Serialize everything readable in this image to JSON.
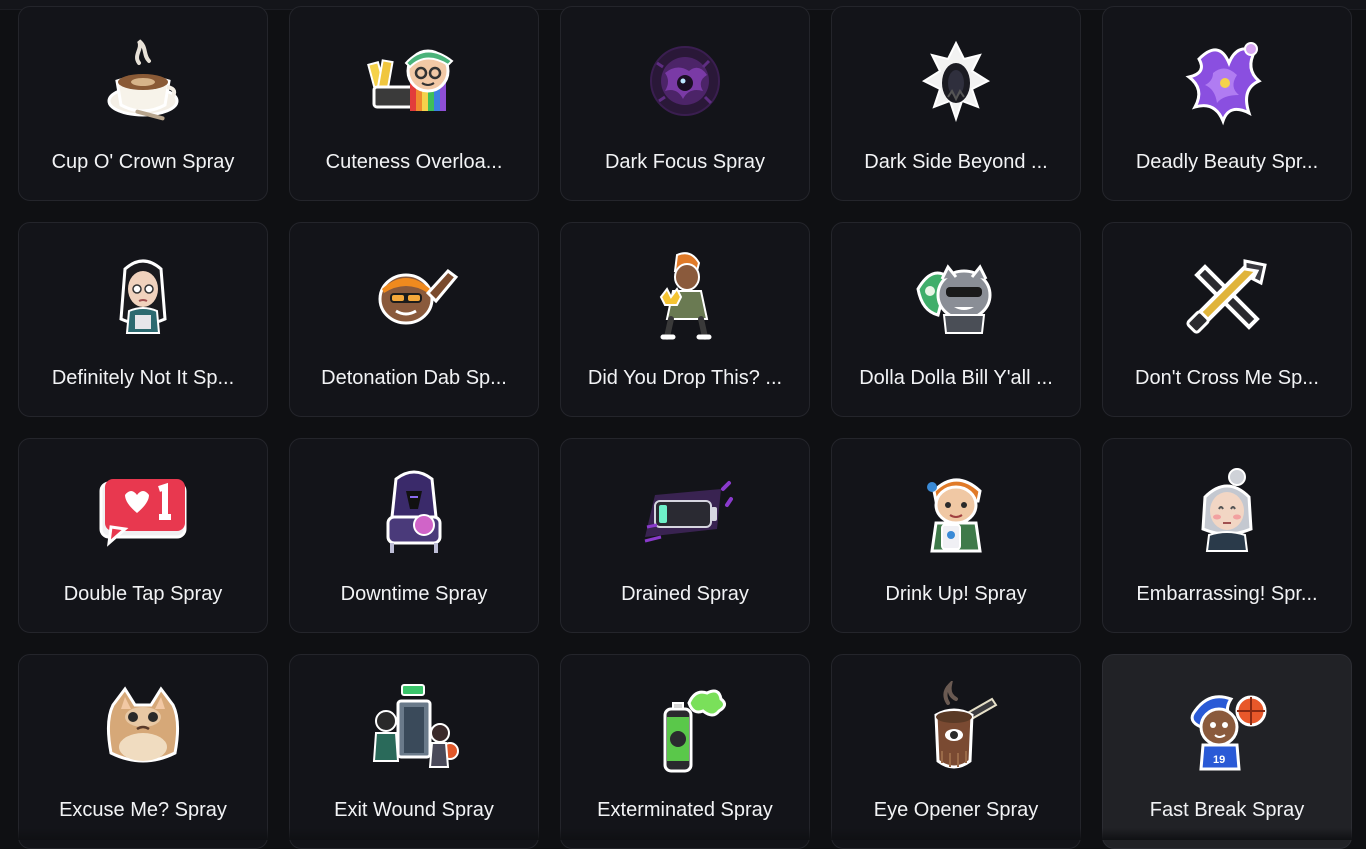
{
  "sprays": [
    {
      "name": "Cup O' Crown Spray",
      "icon": "coffee-cup-icon"
    },
    {
      "name": "Cuteness Overloa...",
      "icon": "rainbow-girl-icon"
    },
    {
      "name": "Dark Focus Spray",
      "icon": "dark-orb-icon"
    },
    {
      "name": "Dark Side Beyond ...",
      "icon": "portal-rift-icon"
    },
    {
      "name": "Deadly Beauty Spr...",
      "icon": "purple-flower-icon"
    },
    {
      "name": "Definitely Not It Sp...",
      "icon": "agent-portrait-icon"
    },
    {
      "name": "Detonation Dab Sp...",
      "icon": "dab-agent-icon"
    },
    {
      "name": "Did You Drop This? ...",
      "icon": "crown-agent-icon"
    },
    {
      "name": "Dolla Dolla Bill Y'all ...",
      "icon": "money-cat-icon"
    },
    {
      "name": "Don't Cross Me Sp...",
      "icon": "crossed-tools-icon"
    },
    {
      "name": "Double Tap Spray",
      "icon": "heart-like-icon"
    },
    {
      "name": "Downtime Spray",
      "icon": "hooded-figure-icon"
    },
    {
      "name": "Drained Spray",
      "icon": "empty-battery-icon"
    },
    {
      "name": "Drink Up! Spray",
      "icon": "drink-agent-icon"
    },
    {
      "name": "Embarrassing! Spr...",
      "icon": "blushing-agent-icon"
    },
    {
      "name": "Excuse Me? Spray",
      "icon": "grumpy-cat-icon"
    },
    {
      "name": "Exit Wound Spray",
      "icon": "exit-door-icon"
    },
    {
      "name": "Exterminated Spray",
      "icon": "spray-can-icon"
    },
    {
      "name": "Eye Opener Spray",
      "icon": "coffee-pot-icon"
    },
    {
      "name": "Fast Break Spray",
      "icon": "basketball-agent-icon"
    }
  ],
  "colors": {
    "background": "#0f1013",
    "card": "#131419",
    "card_hover": "#212226",
    "text": "#f2f3f5"
  }
}
